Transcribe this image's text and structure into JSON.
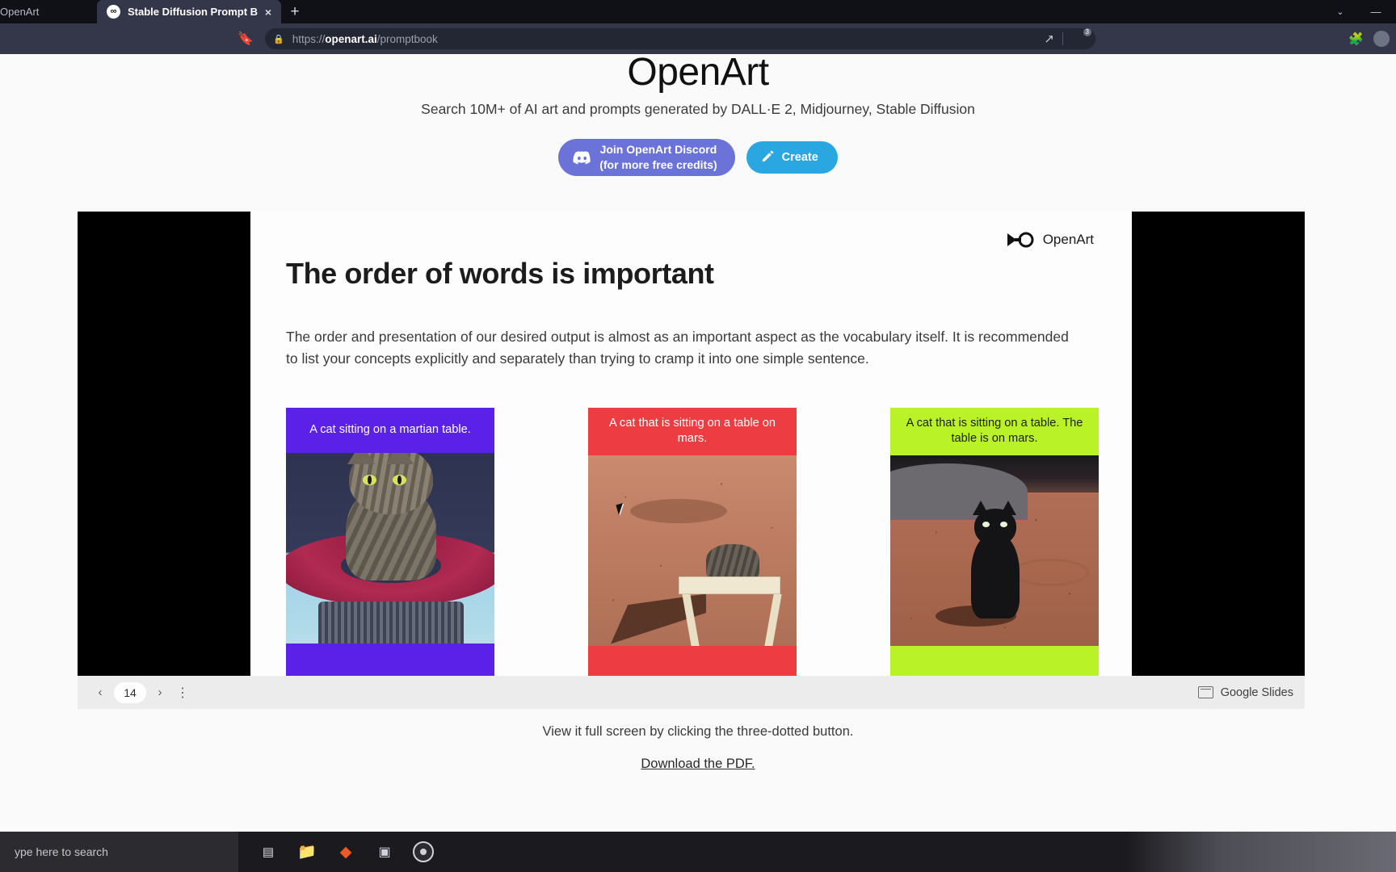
{
  "browser": {
    "tabs": [
      {
        "title": "OpenArt",
        "active": false,
        "partial": true
      },
      {
        "title": "Stable Diffusion Prompt Book - O",
        "active": true,
        "favicon": "openart-infinity-icon",
        "close": "×"
      }
    ],
    "new_tab_label": "+",
    "window_controls": {
      "chevron": "⌄",
      "minimize": "—"
    },
    "omnibox": {
      "lock_icon": "lock-icon",
      "url_prefix": "https://",
      "url_domain": "openart.ai",
      "url_path": "/promptbook",
      "share_icon": "share-icon",
      "shield_badge_count": "3"
    },
    "bookmark_icon": "bookmark-icon",
    "extensions_icon": "puzzle-icon"
  },
  "site": {
    "title": "OpenArt",
    "subtitle": "Search 10M+ of AI art and prompts generated by DALL·E 2, Midjourney, Stable Diffusion",
    "discord_button_line1": "Join OpenArt Discord",
    "discord_button_line2": "(for more free credits)",
    "discord_icon": "discord-icon",
    "create_button": "Create",
    "create_icon": "pencil-icon",
    "hint": "View it full screen by clicking the three-dotted button.",
    "download_link": "Download the PDF."
  },
  "slide": {
    "logo_text": "OpenArt",
    "logo_icon": "openart-infinity-icon",
    "title": "The order of words is important",
    "body": "The order and presentation of our desired output is almost as an important aspect as the vocabulary itself. It is recommended to list your concepts explicitly and separately than trying to cramp it into one simple sentence.",
    "page_number": "14",
    "cards": [
      {
        "caption": "A cat sitting on a martian table.",
        "color": "#5b21e8",
        "image_alt": "tabby-cat-on-red-turntable-illustration"
      },
      {
        "caption": "A cat that is sitting on a table on mars.",
        "color": "#ee3d42",
        "image_alt": "small-tabby-cat-on-white-table-on-mars-surface"
      },
      {
        "caption": "A cat that is sitting on a table. The table is on mars.",
        "color": "#b9f227",
        "caption_text_color": "#1c1c1c",
        "image_alt": "black-cat-sitting-on-mars-surface"
      }
    ]
  },
  "slide_controls": {
    "prev_icon": "chevron-left-icon",
    "next_icon": "chevron-right-icon",
    "page_value": "14",
    "kebab_icon": "kebab-menu-icon",
    "brand_label": "Google Slides",
    "brand_icon": "google-slides-icon"
  },
  "taskbar": {
    "search_placeholder": "ype here to search",
    "items": [
      {
        "name": "task-view-icon",
        "glyph": "⌷"
      },
      {
        "name": "file-explorer-icon",
        "glyph": "🗀"
      },
      {
        "name": "brave-browser-icon",
        "glyph": "◆"
      },
      {
        "name": "terminal-icon",
        "glyph": "▣"
      },
      {
        "name": "obs-studio-icon",
        "glyph": ""
      }
    ]
  }
}
